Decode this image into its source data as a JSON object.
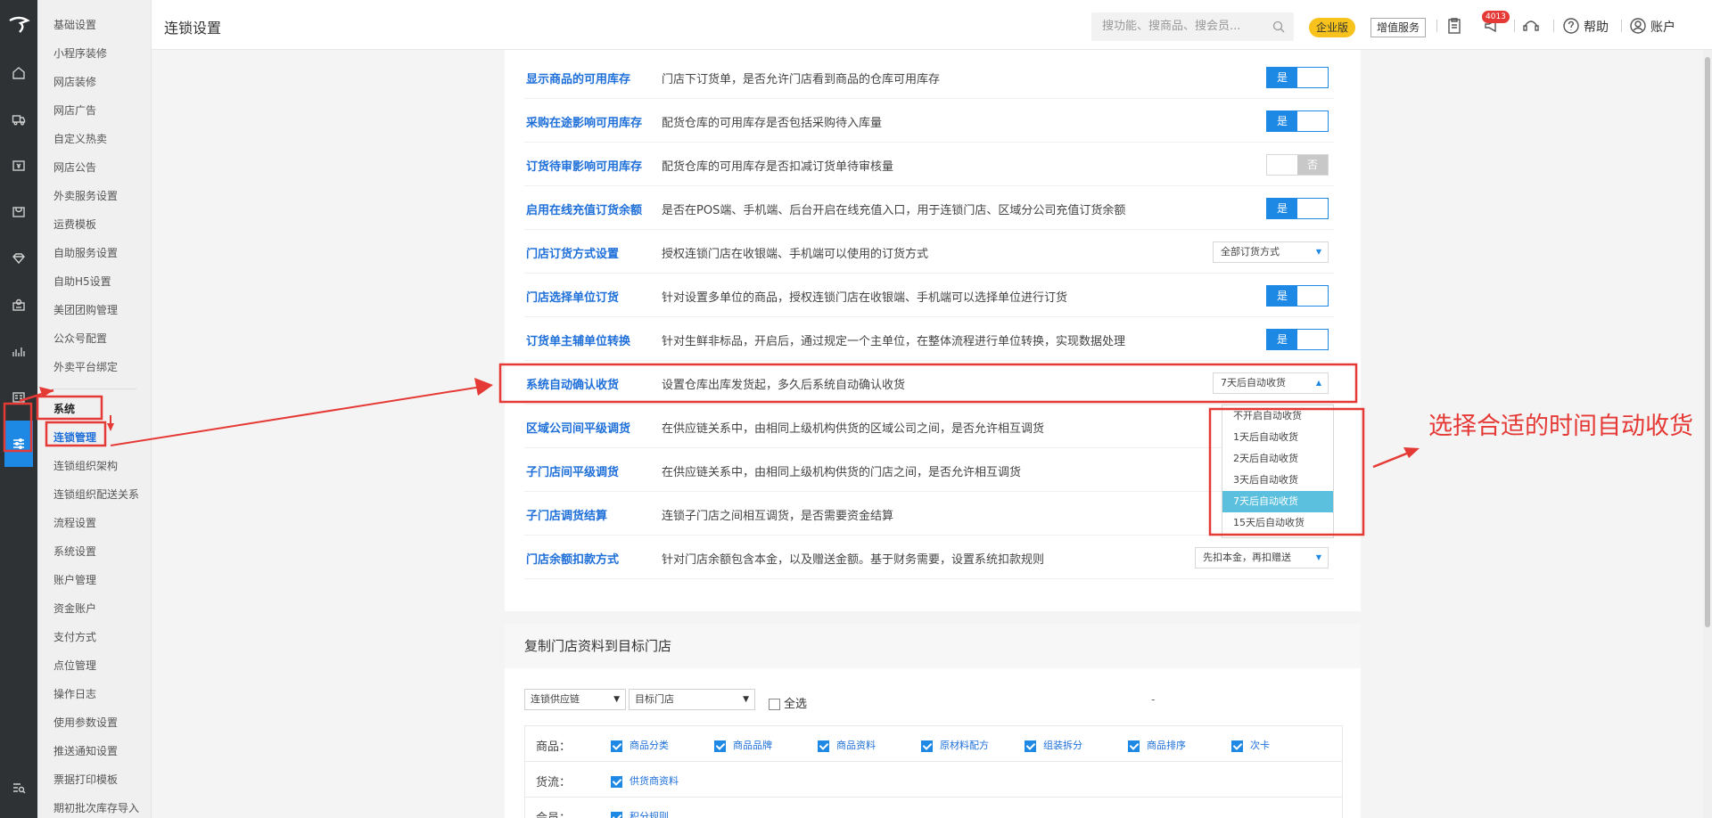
{
  "topbar": {
    "title": "连锁设置",
    "search_placeholder": "搜功能、搜商品、搜会员...",
    "enterprise_badge": "企业版",
    "vas_button": "增值服务",
    "notification_count": "4013",
    "help_label": "帮助",
    "account_label": "账户"
  },
  "menu": {
    "items_top": [
      "基础设置",
      "小程序装修",
      "网店装修",
      "网店广告",
      "自定义热卖",
      "网店公告",
      "外卖服务设置",
      "运费模板",
      "自助服务设置",
      "自助H5设置",
      "美团团购管理",
      "公众号配置",
      "外卖平台绑定"
    ],
    "section": "系统",
    "current": "连锁管理",
    "items_bottom": [
      "连锁组织架构",
      "连锁组织配送关系",
      "流程设置",
      "系统设置",
      "账户管理",
      "资金账户",
      "支付方式",
      "点位管理",
      "操作日志",
      "使用参数设置",
      "推送通知设置",
      "票据打印模板",
      "期初批次库存导入"
    ]
  },
  "rail_icons": [
    "home-icon",
    "truck-icon",
    "cashier-icon",
    "store-icon",
    "diamond-icon",
    "member-icon",
    "chart-icon",
    "report-icon",
    "settings-sliders-icon",
    "search-list-icon"
  ],
  "settings": [
    {
      "title": "显示商品的可用库存",
      "desc": "门店下订货单，是否允许门店看到商品的仓库可用库存",
      "control": "toggle",
      "state": "on",
      "label": "是"
    },
    {
      "title": "采购在途影响可用库存",
      "desc": "配货仓库的可用库存是否包括采购待入库量",
      "control": "toggle",
      "state": "on",
      "label": "是"
    },
    {
      "title": "订货待审影响可用库存",
      "desc": "配货仓库的可用库存是否扣减订货单待审核量",
      "control": "toggle",
      "state": "off",
      "label": "否"
    },
    {
      "title": "启用在线充值订货余额",
      "desc": "是否在POS端、手机端、后台开启在线充值入口，用于连锁门店、区域分公司充值订货余额",
      "control": "toggle",
      "state": "on",
      "label": "是"
    },
    {
      "title": "门店订货方式设置",
      "desc": "授权连锁门店在收银端、手机端可以使用的订货方式",
      "control": "select",
      "label": "全部订货方式"
    },
    {
      "title": "门店选择单位订货",
      "desc": "针对设置多单位的商品，授权连锁门店在收银端、手机端可以选择单位进行订货",
      "control": "toggle",
      "state": "on",
      "label": "是"
    },
    {
      "title": "订货单主辅单位转换",
      "desc": "针对生鲜非标品，开启后，通过规定一个主单位，在整体流程进行单位转换，实现数据处理",
      "control": "toggle",
      "state": "on",
      "label": "是"
    },
    {
      "title": "系统自动确认收货",
      "desc": "设置仓库出库发货起，多久后系统自动确认收货",
      "control": "select",
      "label": "7天后自动收货"
    },
    {
      "title": "区域公司间平级调货",
      "desc": "在供应链关系中，由相同上级机构供货的区域公司之间，是否允许相互调货",
      "control": "none",
      "label": ""
    },
    {
      "title": "子门店间平级调货",
      "desc": "在供应链关系中，由相同上级机构供货的门店之间，是否允许相互调货",
      "control": "none",
      "label": ""
    },
    {
      "title": "子门店调货结算",
      "desc": "连锁子门店之间相互调货，是否需要资金结算",
      "control": "none",
      "label": ""
    },
    {
      "title": "门店余额扣款方式",
      "desc": "针对门店余额包含本金，以及赠送金额。基于财务需要，设置系统扣款规则",
      "control": "select",
      "label": "先扣本金，再扣赠送"
    }
  ],
  "dropdown": {
    "options": [
      "不开启自动收货",
      "1天后自动收货",
      "2天后自动收货",
      "3天后自动收货",
      "7天后自动收货",
      "15天后自动收货"
    ],
    "selected_index": 4
  },
  "copy_panel": {
    "title": "复制门店资料到目标门店",
    "source_select": "连锁供应链",
    "target_select": "目标门店",
    "select_all": "全选",
    "rows": [
      {
        "label": "商品：",
        "items": [
          "商品分类",
          "商品品牌",
          "商品资料",
          "原材料配方",
          "组装拆分",
          "商品排序",
          "次卡"
        ]
      },
      {
        "label": "货流：",
        "items": [
          "供货商资料"
        ]
      },
      {
        "label": "会员：",
        "items": [
          "积分规则"
        ]
      }
    ]
  },
  "annotation": {
    "text": "选择合适的时间自动收货",
    "color": "#e53935"
  }
}
